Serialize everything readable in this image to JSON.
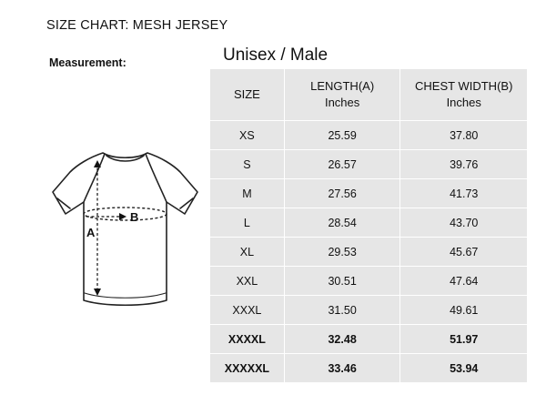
{
  "page": {
    "title": "SIZE CHART: MESH JERSEY",
    "measurement_label": "Measurement:",
    "table_title": "Unisex / Male"
  },
  "diagram": {
    "label_a": "A",
    "label_b": "B"
  },
  "table": {
    "headers": [
      {
        "line1": "SIZE",
        "line2": ""
      },
      {
        "line1": "LENGTH(A)",
        "line2": "Inches"
      },
      {
        "line1": "CHEST WIDTH(B)",
        "line2": "Inches"
      }
    ],
    "rows": [
      {
        "size": "XS",
        "length": "25.59",
        "chest": "37.80"
      },
      {
        "size": "S",
        "length": "26.57",
        "chest": "39.76"
      },
      {
        "size": "M",
        "length": "27.56",
        "chest": "41.73"
      },
      {
        "size": "L",
        "length": "28.54",
        "chest": "43.70"
      },
      {
        "size": "XL",
        "length": "29.53",
        "chest": "45.67"
      },
      {
        "size": "XXL",
        "length": "30.51",
        "chest": "47.64"
      },
      {
        "size": "XXXL",
        "length": "31.50",
        "chest": "49.61"
      },
      {
        "size": "XXXXL",
        "length": "32.48",
        "chest": "51.97"
      },
      {
        "size": "XXXXXL",
        "length": "33.46",
        "chest": "53.94"
      }
    ],
    "bold_rows": [
      7,
      8
    ]
  },
  "colors": {
    "cell_background": "#e6e6e6",
    "shirt_outline": "#222222",
    "measure_arrow": "#111111"
  }
}
